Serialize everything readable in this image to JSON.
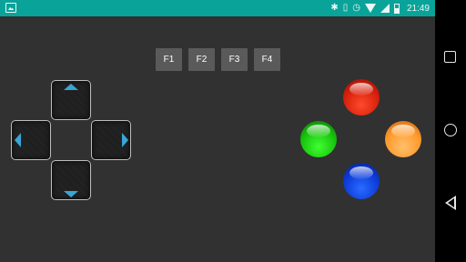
{
  "status_bar": {
    "time": "21:49",
    "icons": [
      "image-notification-icon",
      "bluetooth-icon",
      "vibrate-icon",
      "alarm-icon",
      "wifi-icon",
      "signal-icon",
      "battery-icon"
    ]
  },
  "function_keys": [
    {
      "label": "F1"
    },
    {
      "label": "F2"
    },
    {
      "label": "F3"
    },
    {
      "label": "F4"
    }
  ],
  "dpad": {
    "directions": [
      "up",
      "left",
      "right",
      "down"
    ],
    "arrow_color": "#37a6d6"
  },
  "action_buttons": [
    {
      "name": "red",
      "color": "#e02a12"
    },
    {
      "name": "green",
      "color": "#1fd014"
    },
    {
      "name": "orange",
      "color": "#ffa436"
    },
    {
      "name": "blue",
      "color": "#0f3fe0"
    }
  ],
  "nav_bar": {
    "buttons": [
      "recents",
      "home",
      "back"
    ]
  },
  "colors": {
    "status_bar": "#0aa39a",
    "background": "#313131",
    "fkey": "#5a5a5a"
  }
}
